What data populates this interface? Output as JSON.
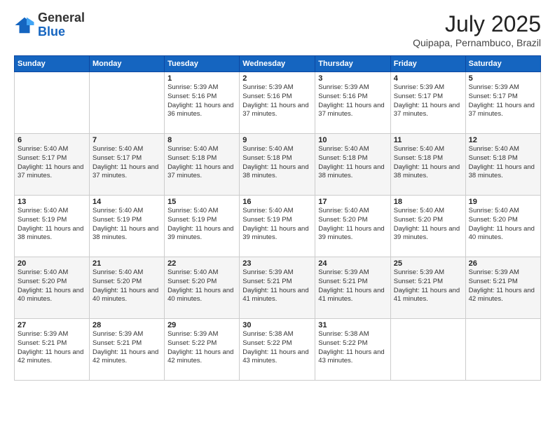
{
  "logo": {
    "general": "General",
    "blue": "Blue"
  },
  "title": {
    "month_year": "July 2025",
    "location": "Quipapa, Pernambuco, Brazil"
  },
  "days_of_week": [
    "Sunday",
    "Monday",
    "Tuesday",
    "Wednesday",
    "Thursday",
    "Friday",
    "Saturday"
  ],
  "weeks": [
    [
      {
        "day": "",
        "detail": ""
      },
      {
        "day": "",
        "detail": ""
      },
      {
        "day": "1",
        "detail": "Sunrise: 5:39 AM\nSunset: 5:16 PM\nDaylight: 11 hours and 36 minutes."
      },
      {
        "day": "2",
        "detail": "Sunrise: 5:39 AM\nSunset: 5:16 PM\nDaylight: 11 hours and 37 minutes."
      },
      {
        "day": "3",
        "detail": "Sunrise: 5:39 AM\nSunset: 5:16 PM\nDaylight: 11 hours and 37 minutes."
      },
      {
        "day": "4",
        "detail": "Sunrise: 5:39 AM\nSunset: 5:17 PM\nDaylight: 11 hours and 37 minutes."
      },
      {
        "day": "5",
        "detail": "Sunrise: 5:39 AM\nSunset: 5:17 PM\nDaylight: 11 hours and 37 minutes."
      }
    ],
    [
      {
        "day": "6",
        "detail": "Sunrise: 5:40 AM\nSunset: 5:17 PM\nDaylight: 11 hours and 37 minutes."
      },
      {
        "day": "7",
        "detail": "Sunrise: 5:40 AM\nSunset: 5:17 PM\nDaylight: 11 hours and 37 minutes."
      },
      {
        "day": "8",
        "detail": "Sunrise: 5:40 AM\nSunset: 5:18 PM\nDaylight: 11 hours and 37 minutes."
      },
      {
        "day": "9",
        "detail": "Sunrise: 5:40 AM\nSunset: 5:18 PM\nDaylight: 11 hours and 38 minutes."
      },
      {
        "day": "10",
        "detail": "Sunrise: 5:40 AM\nSunset: 5:18 PM\nDaylight: 11 hours and 38 minutes."
      },
      {
        "day": "11",
        "detail": "Sunrise: 5:40 AM\nSunset: 5:18 PM\nDaylight: 11 hours and 38 minutes."
      },
      {
        "day": "12",
        "detail": "Sunrise: 5:40 AM\nSunset: 5:18 PM\nDaylight: 11 hours and 38 minutes."
      }
    ],
    [
      {
        "day": "13",
        "detail": "Sunrise: 5:40 AM\nSunset: 5:19 PM\nDaylight: 11 hours and 38 minutes."
      },
      {
        "day": "14",
        "detail": "Sunrise: 5:40 AM\nSunset: 5:19 PM\nDaylight: 11 hours and 38 minutes."
      },
      {
        "day": "15",
        "detail": "Sunrise: 5:40 AM\nSunset: 5:19 PM\nDaylight: 11 hours and 39 minutes."
      },
      {
        "day": "16",
        "detail": "Sunrise: 5:40 AM\nSunset: 5:19 PM\nDaylight: 11 hours and 39 minutes."
      },
      {
        "day": "17",
        "detail": "Sunrise: 5:40 AM\nSunset: 5:20 PM\nDaylight: 11 hours and 39 minutes."
      },
      {
        "day": "18",
        "detail": "Sunrise: 5:40 AM\nSunset: 5:20 PM\nDaylight: 11 hours and 39 minutes."
      },
      {
        "day": "19",
        "detail": "Sunrise: 5:40 AM\nSunset: 5:20 PM\nDaylight: 11 hours and 40 minutes."
      }
    ],
    [
      {
        "day": "20",
        "detail": "Sunrise: 5:40 AM\nSunset: 5:20 PM\nDaylight: 11 hours and 40 minutes."
      },
      {
        "day": "21",
        "detail": "Sunrise: 5:40 AM\nSunset: 5:20 PM\nDaylight: 11 hours and 40 minutes."
      },
      {
        "day": "22",
        "detail": "Sunrise: 5:40 AM\nSunset: 5:20 PM\nDaylight: 11 hours and 40 minutes."
      },
      {
        "day": "23",
        "detail": "Sunrise: 5:39 AM\nSunset: 5:21 PM\nDaylight: 11 hours and 41 minutes."
      },
      {
        "day": "24",
        "detail": "Sunrise: 5:39 AM\nSunset: 5:21 PM\nDaylight: 11 hours and 41 minutes."
      },
      {
        "day": "25",
        "detail": "Sunrise: 5:39 AM\nSunset: 5:21 PM\nDaylight: 11 hours and 41 minutes."
      },
      {
        "day": "26",
        "detail": "Sunrise: 5:39 AM\nSunset: 5:21 PM\nDaylight: 11 hours and 42 minutes."
      }
    ],
    [
      {
        "day": "27",
        "detail": "Sunrise: 5:39 AM\nSunset: 5:21 PM\nDaylight: 11 hours and 42 minutes."
      },
      {
        "day": "28",
        "detail": "Sunrise: 5:39 AM\nSunset: 5:21 PM\nDaylight: 11 hours and 42 minutes."
      },
      {
        "day": "29",
        "detail": "Sunrise: 5:39 AM\nSunset: 5:22 PM\nDaylight: 11 hours and 42 minutes."
      },
      {
        "day": "30",
        "detail": "Sunrise: 5:38 AM\nSunset: 5:22 PM\nDaylight: 11 hours and 43 minutes."
      },
      {
        "day": "31",
        "detail": "Sunrise: 5:38 AM\nSunset: 5:22 PM\nDaylight: 11 hours and 43 minutes."
      },
      {
        "day": "",
        "detail": ""
      },
      {
        "day": "",
        "detail": ""
      }
    ]
  ]
}
